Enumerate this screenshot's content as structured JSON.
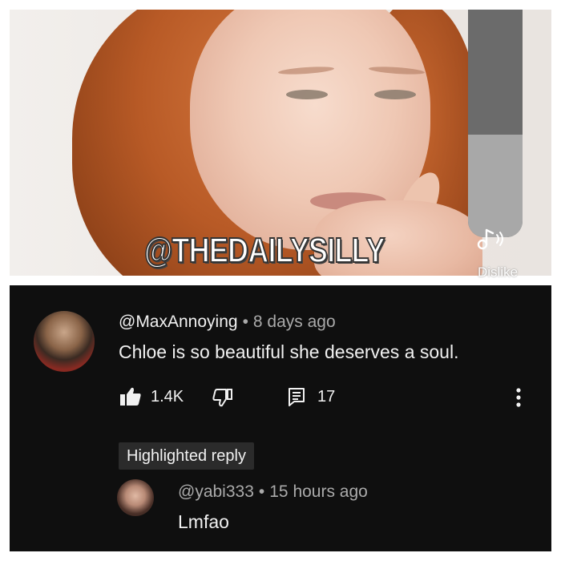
{
  "video": {
    "watermark": "@THEDAILYSILLY",
    "volume_level": 0.45,
    "sound_icon": "music-note-icon",
    "dislike_hint": "Dislike"
  },
  "comment": {
    "handle": "@MaxAnnoying",
    "separator": "•",
    "age": "8 days ago",
    "text": "Chloe is so beautiful she deserves a soul.",
    "likes": "1.4K",
    "replies": "17",
    "icons": {
      "like": "thumbs-up-icon",
      "dislike": "thumbs-down-icon",
      "replies": "comment-icon",
      "more": "more-vertical-icon"
    }
  },
  "reply": {
    "badge": "Highlighted reply",
    "handle": "@yabi333",
    "separator": "•",
    "age": "15 hours ago",
    "text": "Lmfao"
  },
  "colors": {
    "background": "#0f0f0f",
    "text_primary": "#f1f1f1",
    "text_secondary": "#aaaaaa"
  }
}
